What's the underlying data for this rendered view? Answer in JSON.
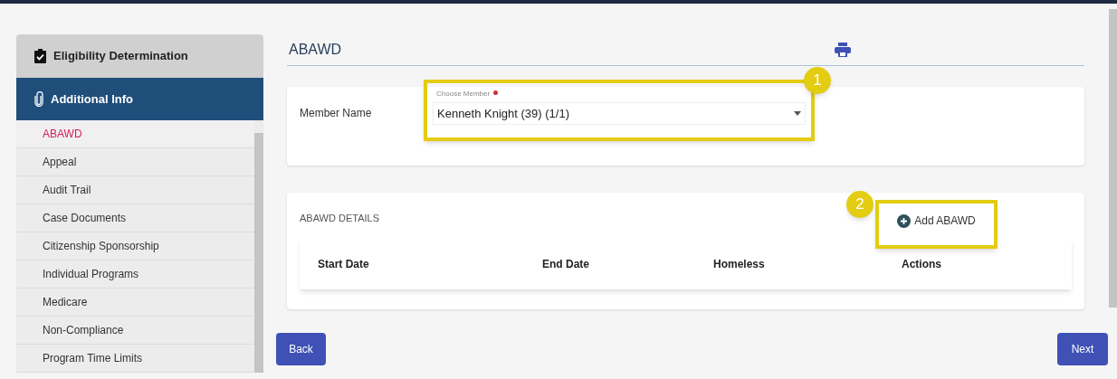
{
  "sidebar": {
    "section": {
      "label": "Eligibility Determination"
    },
    "group": {
      "label": "Additional Info",
      "selected": true
    },
    "items": [
      {
        "label": "ABAWD",
        "selected": true
      },
      {
        "label": "Appeal",
        "selected": false
      },
      {
        "label": "Audit Trail",
        "selected": false
      },
      {
        "label": "Case Documents",
        "selected": false
      },
      {
        "label": "Citizenship Sponsorship",
        "selected": false
      },
      {
        "label": "Individual Programs",
        "selected": false
      },
      {
        "label": "Medicare",
        "selected": false
      },
      {
        "label": "Non-Compliance",
        "selected": false
      },
      {
        "label": "Program Time Limits",
        "selected": false
      }
    ]
  },
  "page_title": "ABAWD",
  "member": {
    "label": "Member Name",
    "select": {
      "floating_label": "Choose Member",
      "required": true,
      "value": "Kenneth Knight (39) (1/1)"
    },
    "callout": "1"
  },
  "details": {
    "title": "ABAWD DETAILS",
    "add_button": {
      "label": "Add ABAWD",
      "callout": "2"
    },
    "table": {
      "columns": [
        "Start Date",
        "End Date",
        "Homeless",
        "Actions"
      ]
    }
  },
  "buttons": {
    "back": "Back",
    "next": "Next"
  }
}
